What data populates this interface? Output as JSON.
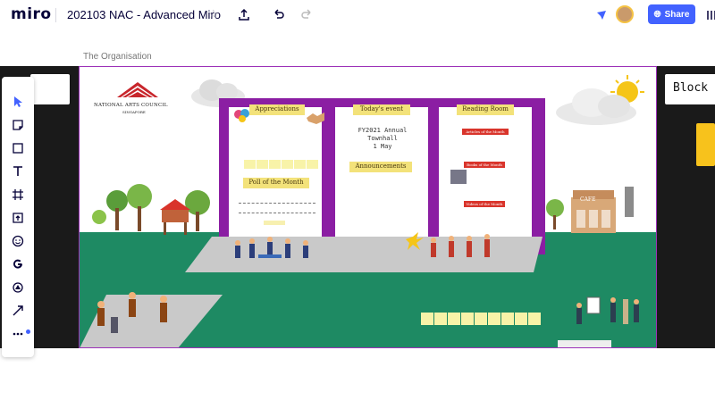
{
  "app": {
    "logo": "miro"
  },
  "board": {
    "title": "202103 NAC - Advanced Miro"
  },
  "header": {
    "share_label": "Share"
  },
  "frame": {
    "label": "The Organisation"
  },
  "side_card": {
    "text": "Block A"
  },
  "org": {
    "name": "NATIONAL ARTS COUNCIL",
    "country": "SINGAPORE"
  },
  "boards": {
    "appreciations": "Appreciations",
    "poll": "Poll of the Month",
    "todays_event": "Today's event",
    "event_line1": "FY2021 Annual",
    "event_line2": "Townhall",
    "event_line3": "1 May",
    "announcements": "Announcements",
    "reading_room": "Reading Room",
    "tag1": "Articles of the Month",
    "tag2": "Books of the Month",
    "tag3": "Videos of the Month"
  },
  "cafe_label": "CAFE",
  "colors": {
    "accent": "#4262ff",
    "grass": "#1e8a63",
    "panel": "#8b1ea3",
    "header_yellow": "#f3e27a"
  }
}
